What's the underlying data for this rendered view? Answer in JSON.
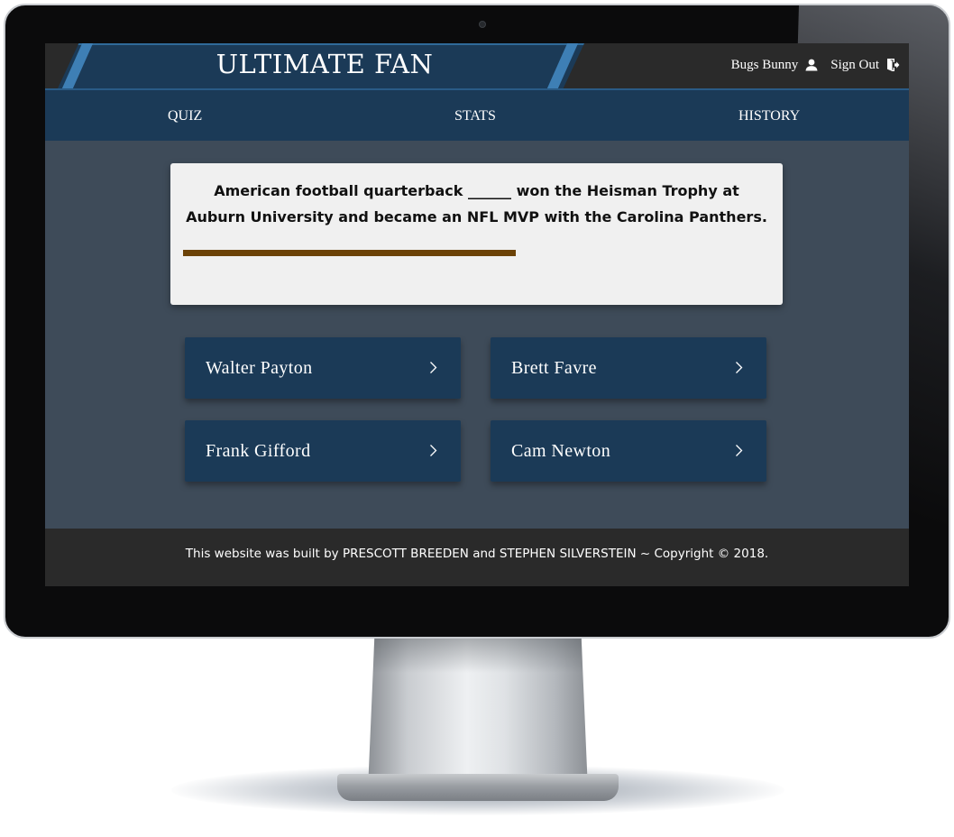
{
  "header": {
    "brand_title": "ULTIMATE FAN",
    "user_name": "Bugs Bunny",
    "sign_out_label": "Sign Out"
  },
  "nav": {
    "items": [
      {
        "label": "QUIZ"
      },
      {
        "label": "STATS"
      },
      {
        "label": "HISTORY"
      }
    ]
  },
  "quiz": {
    "question": "American football quarterback ______ won the Heisman Trophy at Auburn University and became an NFL MVP with the Carolina Panthers.",
    "timer_remaining_fraction": 0.567,
    "timer_color": "#6b4206",
    "answers": [
      {
        "label": "Walter Payton"
      },
      {
        "label": "Brett Favre"
      },
      {
        "label": "Frank Gifford"
      },
      {
        "label": "Cam Newton"
      }
    ]
  },
  "footer": {
    "text": "This website was built by PRESCOTT BREEDEN and STEPHEN SILVERSTEIN ~ Copyright © 2018."
  },
  "colors": {
    "brand_navy": "#1b3a57",
    "accent_blue": "#3e7fb5",
    "page_background": "#3e4b59",
    "bar_dark": "#2a2a2a",
    "card_background": "#f0f0f0"
  },
  "icons": {
    "user": "user-icon",
    "sign_out": "sign-out-icon",
    "answer_arrow": "chevron-right-icon"
  }
}
